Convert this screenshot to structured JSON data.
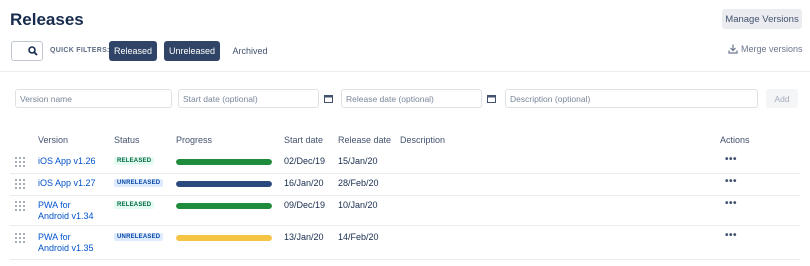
{
  "page": {
    "title": "Releases"
  },
  "header": {
    "manage_label": "Manage Versions"
  },
  "filters": {
    "search_icon": "search-icon",
    "quick_label": "QUICK FILTERS:",
    "released": "Released",
    "unreleased": "Unreleased",
    "archived": "Archived",
    "merge_label": "Merge versions"
  },
  "form": {
    "version_placeholder": "Version name",
    "start_placeholder": "Start date (optional)",
    "release_placeholder": "Release date (optional)",
    "description_placeholder": "Description (optional)",
    "add_label": "Add"
  },
  "table": {
    "headers": {
      "version": "Version",
      "status": "Status",
      "progress": "Progress",
      "start": "Start date",
      "release": "Release date",
      "description": "Description",
      "actions": "Actions"
    },
    "rows": [
      {
        "version": "iOS App v1.26",
        "status": "RELEASED",
        "progress": 1.0,
        "progress_color": "#1e8c3c",
        "start": "02/Dec/19",
        "release": "15/Jan/20",
        "actions": "•••"
      },
      {
        "version": "iOS App v1.27",
        "status": "UNRELEASED",
        "progress": 1.0,
        "progress_color": "#2a4a7d",
        "start": "16/Jan/20",
        "release": "28/Feb/20",
        "actions": "•••"
      },
      {
        "version_line1": "PWA for",
        "version_line2": "Android v1.34",
        "status": "RELEASED",
        "progress": 1.0,
        "progress_color": "#1e8c3c",
        "start": "09/Dec/19",
        "release": "10/Jan/20",
        "actions": "•••"
      },
      {
        "version_line1": "PWA for",
        "version_line2": "Android v1.35",
        "status": "UNRELEASED",
        "progress": 1.0,
        "progress_color": "#f5c443",
        "start": "13/Jan/20",
        "release": "14/Feb/20",
        "actions": "•••"
      }
    ]
  },
  "colors": {
    "primary_button": "#2f4466",
    "link": "#0052cc",
    "released_bg": "#e3fcef",
    "unreleased_bg": "#deebff"
  }
}
